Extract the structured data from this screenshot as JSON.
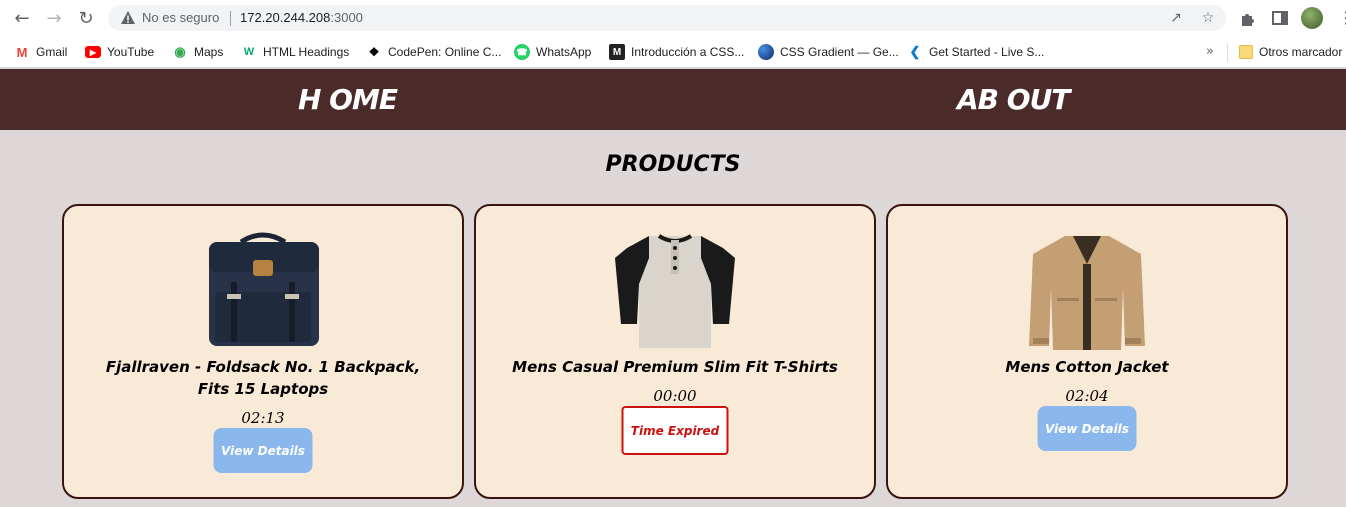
{
  "browser": {
    "security_label": "No es seguro",
    "url_host": "172.20.244.208",
    "url_port": ":3000",
    "bookmarks": [
      {
        "label": "Gmail",
        "icon": "gmail-icon"
      },
      {
        "label": "YouTube",
        "icon": "youtube-icon"
      },
      {
        "label": "Maps",
        "icon": "maps-icon"
      },
      {
        "label": "HTML Headings",
        "icon": "w3schools-icon"
      },
      {
        "label": "CodePen: Online C...",
        "icon": "codepen-icon"
      },
      {
        "label": "WhatsApp",
        "icon": "whatsapp-icon"
      },
      {
        "label": "Introducción a CSS...",
        "icon": "m-icon"
      },
      {
        "label": "CSS Gradient — Ge...",
        "icon": "gradient-icon"
      },
      {
        "label": "Get Started - Live S...",
        "icon": "vscode-icon"
      }
    ],
    "more_bookmarks": "»",
    "other_bookmarks": "Otros marcador"
  },
  "nav": {
    "home": "H OME",
    "about": "AB OUT"
  },
  "page": {
    "title": "PRODUCTS"
  },
  "products": [
    {
      "title": "Fjallraven - Foldsack No. 1 Backpack, Fits 15 Laptops",
      "timer": "02:13",
      "action": "View Details",
      "image": "backpack-image"
    },
    {
      "title": "Mens Casual Premium Slim Fit T-Shirts",
      "timer": "00:00",
      "action": "Time Expired",
      "image": "tshirt-image"
    },
    {
      "title": "Mens Cotton Jacket",
      "timer": "02:04",
      "action": "View Details",
      "image": "jacket-image"
    }
  ],
  "colors": {
    "navbar": "#4a2b29",
    "page_bg": "#ddd7d7",
    "card_bg": "#f9ead8",
    "card_border": "#3a1410",
    "button": "#8ab8ec",
    "expired": "#cc1111"
  }
}
